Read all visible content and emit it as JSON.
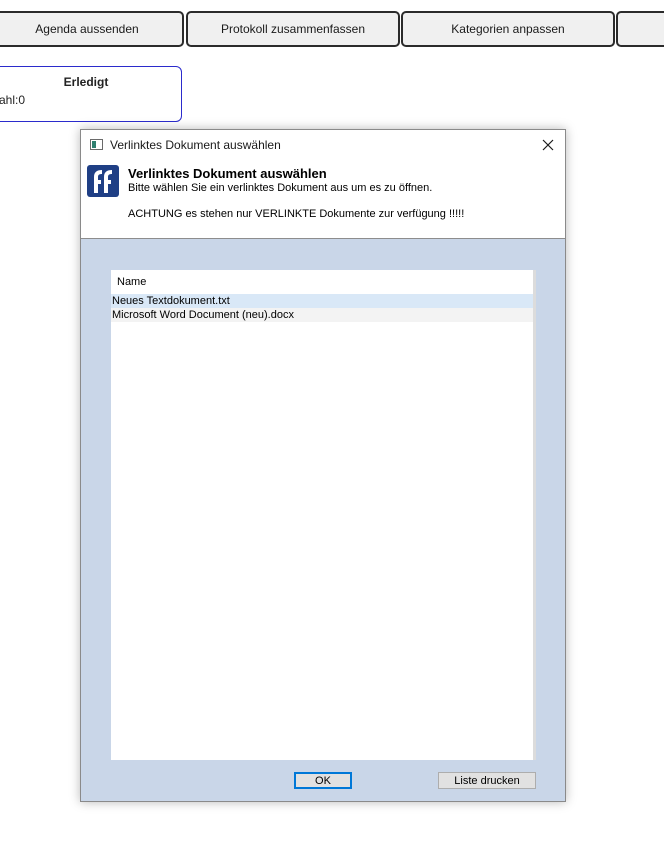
{
  "toolbar": {
    "buttons": [
      "Agenda aussenden",
      "Protokoll zusammenfassen",
      "Kategorien anpassen",
      ""
    ]
  },
  "status_card": {
    "title": "Erledigt",
    "count_text": "ahl:0"
  },
  "dialog": {
    "window_title": "Verlinktes Dokument auswählen",
    "header_title": "Verlinktes Dokument auswählen",
    "header_subtitle": "Bitte wählen Sie ein verlinktes Dokument aus um es zu öffnen.",
    "warning": "ACHTUNG es stehen nur VERLINKTE Dokumente zur verfügung !!!!!",
    "list": {
      "column_header": "Name",
      "items": [
        "Neues Textdokument.txt",
        "Microsoft Word Document (neu).docx"
      ],
      "selected_index": 0
    },
    "ok_label": "OK",
    "print_label": "Liste drucken"
  },
  "icons": {
    "window_icon": "app-window-icon",
    "close": "close-icon",
    "logo": "ff-logo-icon"
  }
}
